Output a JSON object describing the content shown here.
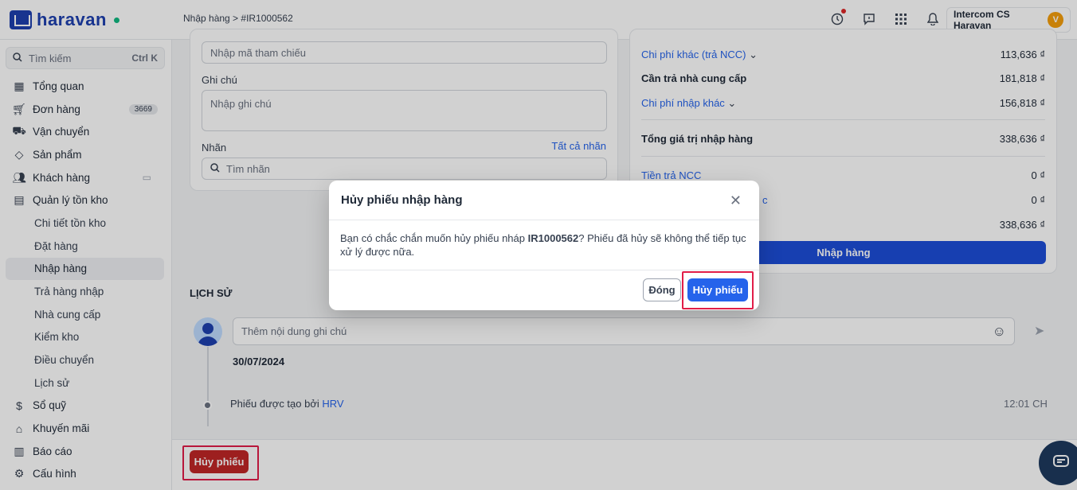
{
  "app": {
    "brand": "haravan"
  },
  "header": {
    "breadcrumb": "Nhập hàng > #IR1000562",
    "account_name": "Intercom CS Haravan",
    "account_initial": "V"
  },
  "sidebar": {
    "search_placeholder": "Tìm kiếm",
    "search_shortcut": "Ctrl K",
    "items": [
      {
        "label": "Tổng quan",
        "icon": "dashboard-icon"
      },
      {
        "label": "Đơn hàng",
        "icon": "cart-icon",
        "badge": "3669"
      },
      {
        "label": "Vận chuyển",
        "icon": "truck-icon"
      },
      {
        "label": "Sản phẩm",
        "icon": "tag-icon"
      },
      {
        "label": "Khách hàng",
        "icon": "users-icon"
      },
      {
        "label": "Quản lý tồn kho",
        "icon": "inventory-icon"
      }
    ],
    "sub_items": [
      "Chi tiết tồn kho",
      "Đặt hàng",
      "Nhập hàng",
      "Trả hàng nhập",
      "Nhà cung cấp",
      "Kiểm kho",
      "Điều chuyển",
      "Lịch sử"
    ],
    "bottom_items": [
      {
        "label": "Sổ quỹ",
        "icon": "money-icon"
      },
      {
        "label": "Khuyến mãi",
        "icon": "gift-icon"
      },
      {
        "label": "Báo cáo",
        "icon": "chart-icon"
      },
      {
        "label": "Cấu hình",
        "icon": "gear-icon"
      }
    ]
  },
  "form": {
    "ref_placeholder": "Nhập mã tham chiếu",
    "note_label": "Ghi chú",
    "note_placeholder": "Nhập ghi chú",
    "tag_label": "Nhãn",
    "all_tags_link": "Tất cả nhãn",
    "tag_search_placeholder": "Tìm nhãn"
  },
  "summary": {
    "other_cost_label": "Chi phí khác (trả NCC)",
    "other_cost_value": "113,636 ₫",
    "payable_label": "Cần trả nhà cung cấp",
    "payable_value": "181,818 ₫",
    "import_cost_label": "Chi phí nhập khác",
    "import_cost_value": "156,818 ₫",
    "total_label": "Tổng giá trị nhập hàng",
    "total_value": "338,636 ₫",
    "paid_label": "Tiền trả NCC",
    "paid_value": "0 ₫",
    "row6_partial": "c",
    "row6_value": "0 ₫",
    "row7_value": "338,636 ₫",
    "import_button": "Nhập hàng"
  },
  "history": {
    "title": "LỊCH SỬ",
    "note_placeholder": "Thêm nội dung ghi chú",
    "date": "30/07/2024",
    "event_text": "Phiếu được tạo bởi",
    "event_user": "HRV",
    "event_time": "12:01 CH"
  },
  "footer": {
    "cancel_button": "Hủy phiếu"
  },
  "modal": {
    "title": "Hủy phiếu nhập hàng",
    "body_prefix": "Bạn có chắc chắn muốn hủy phiếu nháp ",
    "body_code": "IR1000562",
    "body_suffix": "? Phiếu đã hủy sẽ không thể tiếp tục xử lý được nữa.",
    "close_button": "Đóng",
    "confirm_button": "Hủy phiếu"
  },
  "colors": {
    "primary": "#1d4ed8",
    "danger": "#c02626",
    "highlight": "#e11d48"
  }
}
